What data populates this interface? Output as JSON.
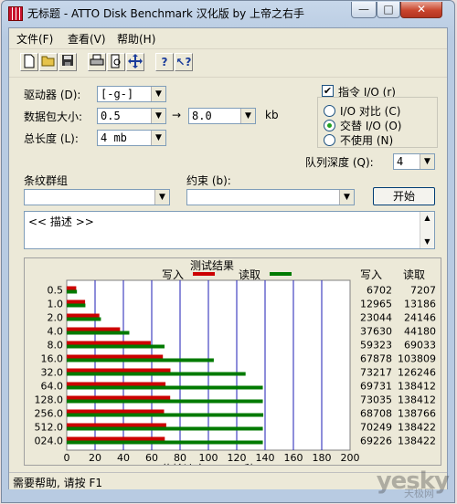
{
  "window": {
    "title": "无标题 - ATTO Disk Benchmark 汉化版 by 上帝之右手",
    "minimize": "—",
    "maximize": "□",
    "close": "✕"
  },
  "menu": [
    "文件(F)",
    "查看(V)",
    "帮助(H)"
  ],
  "toolbar": [
    "new-icon",
    "open-icon",
    "save-icon",
    "print-icon",
    "print-preview-icon",
    "move-icon",
    "help-icon",
    "context-help-icon"
  ],
  "settings": {
    "drive_label": "驱动器 (D):",
    "drive_value": "[-g-]",
    "transfer_label": "数据包大小:",
    "transfer_from": "0.5",
    "transfer_to": "8.0",
    "transfer_unit": "kb",
    "length_label": "总长度 (L):",
    "length_value": "4 mb",
    "overlapped_label": "指令 I/O (r)",
    "overlapped_checked": true,
    "io_compare_label": "I/O 对比 (C)",
    "neither_overlap_label": "交替 I/O (O)",
    "neither_label": "不使用 (N)",
    "selected_mode": "交替 I/O (O)",
    "queue_label": "队列深度 (Q):",
    "queue_value": "4",
    "raid_label": "条纹群组",
    "restrict_label": "约束 (b):",
    "start_button": "开始",
    "description": "<< 描述 >>"
  },
  "results": {
    "title": "测试结果",
    "write_label": "写入",
    "read_label": "读取",
    "write_col": "写入",
    "read_col": "读取",
    "xlabel": "传输速率 - MB / 秒"
  },
  "chart_data": {
    "type": "bar",
    "title": "测试结果",
    "xlabel": "传输速率 - MB / 秒",
    "ylabel": "",
    "xlim": [
      0,
      200
    ],
    "xticks": [
      0,
      20,
      40,
      60,
      80,
      100,
      120,
      140,
      160,
      180,
      200
    ],
    "categories": [
      "0.5",
      "1.0",
      "2.0",
      "4.0",
      "8.0",
      "16.0",
      "32.0",
      "64.0",
      "128.0",
      "256.0",
      "512.0",
      "024.0"
    ],
    "series": [
      {
        "name": "写入",
        "color": "#cc0000",
        "values": [
          6702,
          12965,
          23044,
          37630,
          59323,
          67878,
          73217,
          69731,
          73035,
          68708,
          70249,
          69226
        ]
      },
      {
        "name": "读取",
        "color": "#007a00",
        "values": [
          7207,
          13186,
          24146,
          44180,
          69033,
          103809,
          126246,
          138412,
          138412,
          138766,
          138422,
          138422
        ]
      }
    ],
    "value_unit_divisor": 1000,
    "grid": true,
    "legend": "top"
  },
  "status": "需要帮助, 请按 F1",
  "watermark": {
    "brand": "yesky",
    "sub": "天极网"
  }
}
